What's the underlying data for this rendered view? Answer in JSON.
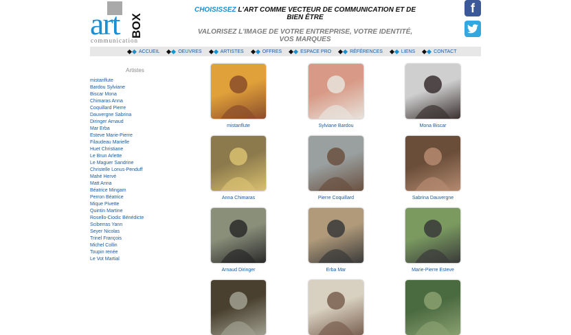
{
  "logo": {
    "art": "art",
    "box": "BOX",
    "subtitle": "communication"
  },
  "tagline": {
    "emphasis": "CHOISISSEZ",
    "line1_rest": "L'ART COMME VECTEUR DE COMMUNICATION ET DE BIEN ÊTRE",
    "line2": "VALORISEZ L'IMAGE DE VOTRE ENTREPRISE, VOTRE IDENTITÉ, VOS MARQUES"
  },
  "social": {
    "facebook_glyph": "f",
    "twitter_glyph": "🐦"
  },
  "nav": [
    "ACCUEIL",
    "OEUVRES",
    "ARTISTES",
    "OFFRES",
    "ESPACE PRO",
    "RÉFÉRENCES",
    "LIENS",
    "CONTACT"
  ],
  "sidebar": {
    "title": "Artistes",
    "artists": [
      "mistanflute",
      "Bardou Sylviane",
      "Biscar Mona",
      "Chimaras Anna",
      "Coquillard Pierre",
      "Dauvergne Sabrina",
      "Diringer Arnaud",
      "Mar Erba",
      "Esteve Marie-Pierre",
      "Filaudeau Marielle",
      "Huet Christiane",
      "Le Brun Arlette",
      "Le Maguer Sandrine",
      "Christelle Lonus-Penduff",
      "Mahé Hervé",
      "Matt Anna",
      "Béatrice Mingam",
      "Perron Béatrice",
      "Mique Pivette",
      "Quintin Martine",
      "Rosello-Ciodic Bénédicte",
      "Sciberras Yann",
      "Seyer Nicolas",
      "Trinel François",
      "Michel Collin",
      "Toupin renée",
      "Le Vot Martial"
    ]
  },
  "gallery": [
    {
      "name": "mistanflute",
      "bg": "#e0a03a",
      "fg": "#8a4d2a"
    },
    {
      "name": "Sylviane Bardou",
      "bg": "#d89a86",
      "fg": "#e8e3dc"
    },
    {
      "name": "Mona Biscar",
      "bg": "#cfcfcf",
      "fg": "#3a3030"
    },
    {
      "name": "Anna Chimaras",
      "bg": "#8c7a4c",
      "fg": "#d8c070"
    },
    {
      "name": "Pierre Coquillard",
      "bg": "#9aa0a0",
      "fg": "#6a5040"
    },
    {
      "name": "Sabrina Dauvergne",
      "bg": "#6a4e3a",
      "fg": "#b58a70"
    },
    {
      "name": "Arnaud Diringer",
      "bg": "#8a8f7a",
      "fg": "#2a2a2a"
    },
    {
      "name": "Erba Mar",
      "bg": "#b09a7a",
      "fg": "#3a3a3a"
    },
    {
      "name": "Marie-Pierre Esteve",
      "bg": "#7a9a60",
      "fg": "#3a3a3a"
    },
    {
      "name": "",
      "bg": "#4a4030",
      "fg": "#a0a090"
    },
    {
      "name": "",
      "bg": "#d8d0c0",
      "fg": "#7a6050"
    },
    {
      "name": "",
      "bg": "#4a6a40",
      "fg": "#8aa070"
    }
  ]
}
